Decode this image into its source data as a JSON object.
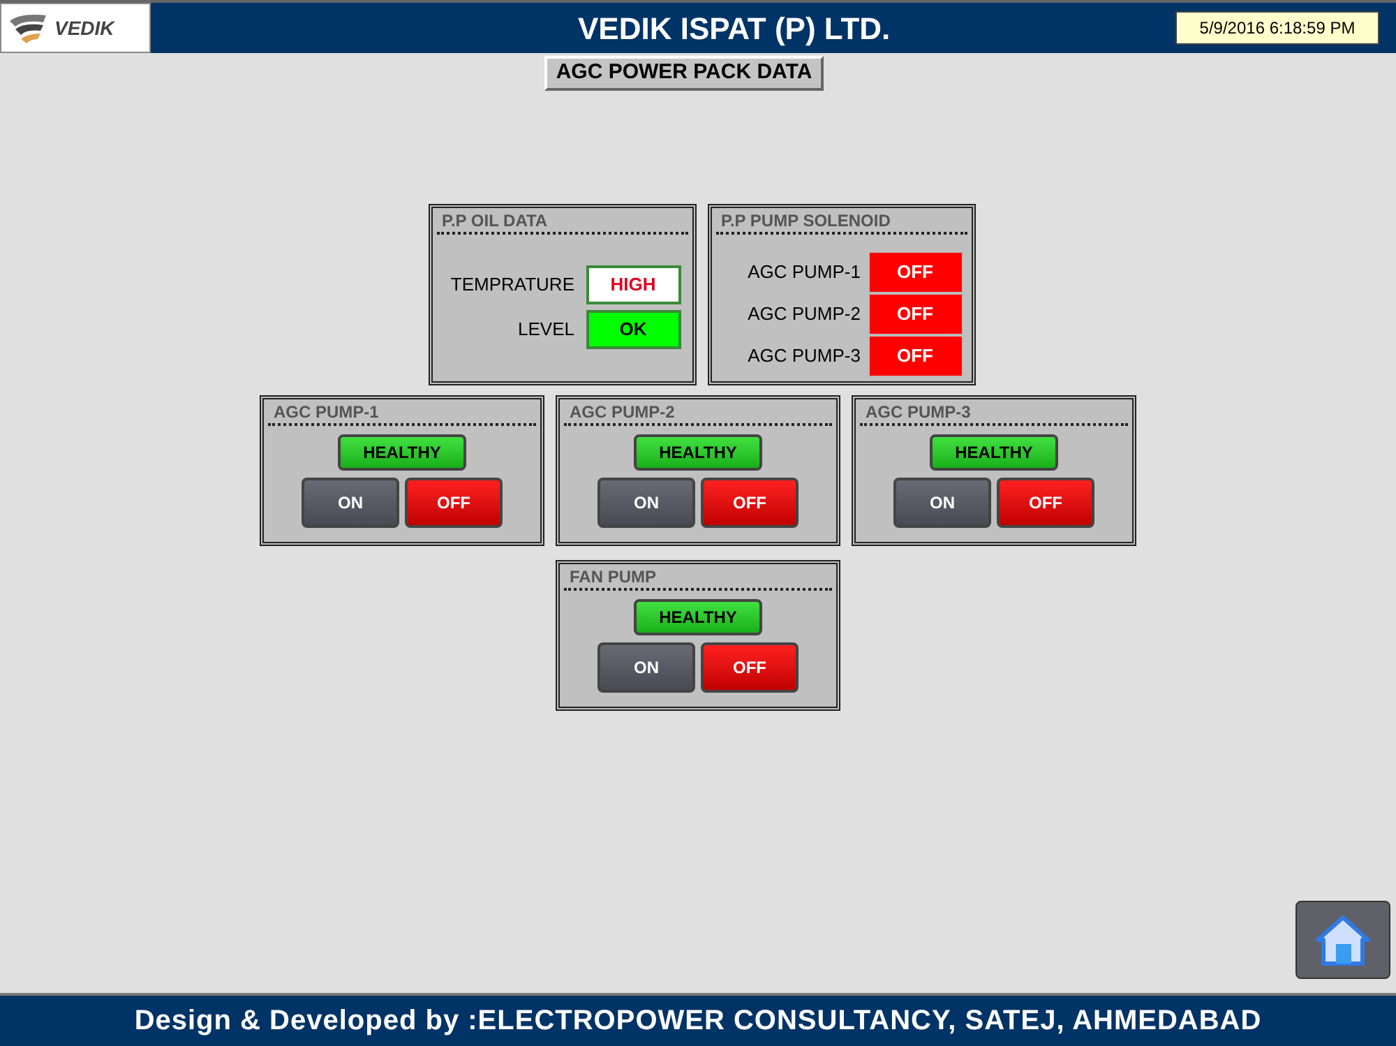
{
  "header": {
    "logo_text": "VEDIK",
    "title": "VEDIK ISPAT (P) LTD.",
    "datetime": "5/9/2016 6:18:59 PM"
  },
  "screen_title": "AGC POWER PACK DATA",
  "oil_data": {
    "title": "P.P OIL DATA",
    "rows": [
      {
        "label": "TEMPRATURE",
        "value": "HIGH",
        "kind": "alarm"
      },
      {
        "label": "LEVEL",
        "value": "OK",
        "kind": "normal"
      }
    ]
  },
  "solenoid": {
    "title": "P.P PUMP SOLENOID",
    "rows": [
      {
        "label": "AGC PUMP-1",
        "value": "OFF",
        "on": false
      },
      {
        "label": "AGC PUMP-2",
        "value": "OFF",
        "on": false
      },
      {
        "label": "AGC PUMP-3",
        "value": "OFF",
        "on": false
      }
    ]
  },
  "pumps": [
    {
      "title": "AGC PUMP-1",
      "health": "HEALTHY",
      "healthy": true,
      "on_label": "ON",
      "off_label": "OFF",
      "running": false
    },
    {
      "title": "AGC PUMP-2",
      "health": "HEALTHY",
      "healthy": true,
      "on_label": "ON",
      "off_label": "OFF",
      "running": false
    },
    {
      "title": "AGC PUMP-3",
      "health": "HEALTHY",
      "healthy": true,
      "on_label": "ON",
      "off_label": "OFF",
      "running": false
    },
    {
      "title": "FAN PUMP",
      "health": "HEALTHY",
      "healthy": true,
      "on_label": "ON",
      "off_label": "OFF",
      "running": false
    }
  ],
  "footer": "Design & Developed by :ELECTROPOWER CONSULTANCY, SATEJ, AHMEDABAD"
}
